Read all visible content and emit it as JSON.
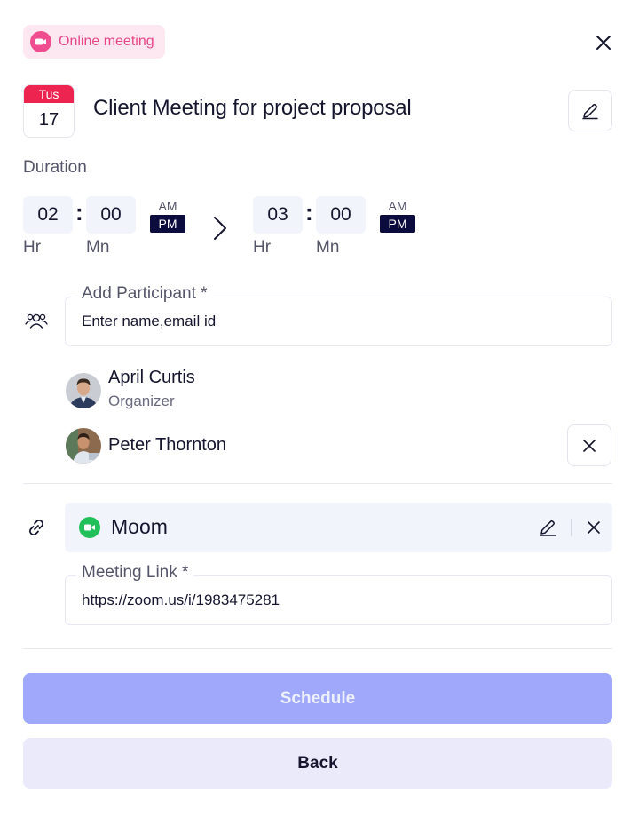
{
  "badge": {
    "label": "Online meeting",
    "icon": "video-icon",
    "color": "#ef4d8f"
  },
  "event": {
    "day": "Tus",
    "date": "17",
    "title": "Client Meeting for project proposal"
  },
  "duration": {
    "label": "Duration",
    "start": {
      "hour": "02",
      "minute": "00",
      "hour_unit": "Hr",
      "minute_unit": "Mn",
      "am": "AM",
      "pm": "PM",
      "selected": "PM"
    },
    "end": {
      "hour": "03",
      "minute": "00",
      "hour_unit": "Hr",
      "minute_unit": "Mn",
      "am": "AM",
      "pm": "PM",
      "selected": "PM"
    }
  },
  "participants_field": {
    "label": "Add Participant *",
    "value": "Enter name,email id"
  },
  "participants": [
    {
      "name": "April Curtis",
      "role": "Organizer"
    },
    {
      "name": "Peter Thornton"
    }
  ],
  "app": {
    "name": "Moom",
    "color": "#22c05b"
  },
  "link_field": {
    "label": "Meeting Link *",
    "value": "https://zoom.us/i/1983475281"
  },
  "actions": {
    "schedule": "Schedule",
    "back": "Back"
  },
  "colors": {
    "accent": "#9fa8fb",
    "dark": "#0b0b3d",
    "date_red": "#ee2450"
  }
}
